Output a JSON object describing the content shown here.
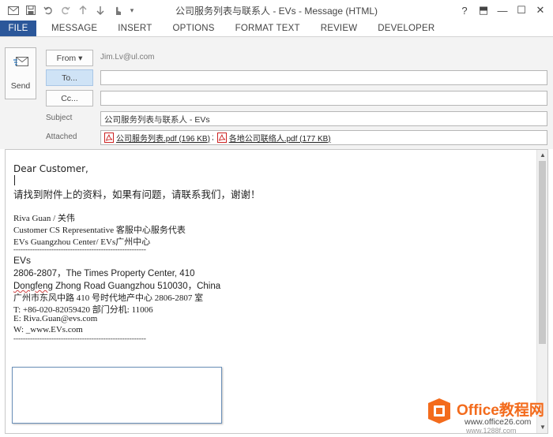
{
  "window": {
    "title": "公司服务列表与联系人 - EVs - Message (HTML)",
    "controls": [
      "?",
      "⬒",
      "—",
      "☐",
      "✕"
    ]
  },
  "ribbon": {
    "tabs": [
      "FILE",
      "MESSAGE",
      "INSERT",
      "OPTIONS",
      "FORMAT TEXT",
      "REVIEW",
      "DEVELOPER"
    ],
    "active_tab": "FILE",
    "accent_color": "#2b579a"
  },
  "compose": {
    "send_label": "Send",
    "from_label": "From ▾",
    "from_value": "Jim.Lv@ul.com",
    "to_label": "To...",
    "to_value": "",
    "cc_label": "Cc...",
    "cc_value": "",
    "subject_label": "Subject",
    "subject_value": "公司服务列表与联系人 - EVs",
    "attached_label": "Attached",
    "attachments": [
      {
        "name": "公司服务列表.pdf (196 KB)",
        "separator": ";"
      },
      {
        "name": "各地公司联络人.pdf (177 KB)",
        "separator": ""
      }
    ]
  },
  "body": {
    "greeting": "Dear Customer,",
    "message": "请找到附件上的资料，如果有问题，请联系我们，谢谢！",
    "sig_name": "Riva Guan / 关伟",
    "sig_title": "Customer CS Representative 客服中心服务代表",
    "sig_center": "EVs Guangzhou Center/ EVs广州中心",
    "separator1": "--------------------------------------------------------",
    "company": "EVs",
    "addr1": "2806-2807，The Times Property Center, 410",
    "addr2_a": "Dongfeng",
    "addr2_b": " Zhong Road Guangzhou 510030，China",
    "addr_cn": "广州市东风中路 410 号时代地产中心 2806-2807 室",
    "phone": "T: +86-020-82059420 部门分机: 11006",
    "email": "E: Riva.Guan@evs.com",
    "web": "W: _www.EVs.com",
    "separator2": "--------------------------------------------------------"
  },
  "watermark": {
    "title": "Office教程网",
    "url": "www.office26.com",
    "url2": "www.1288f.com",
    "color": "#f36b1c"
  }
}
